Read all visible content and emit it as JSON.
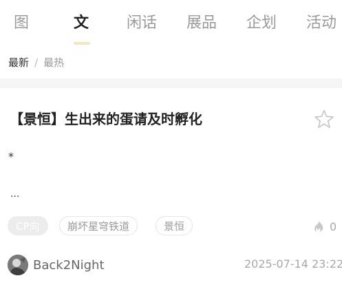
{
  "tabs": [
    {
      "label": "图",
      "active": false
    },
    {
      "label": "文",
      "active": true
    },
    {
      "label": "闲话",
      "active": false
    },
    {
      "label": "展品",
      "active": false
    },
    {
      "label": "企划",
      "active": false
    },
    {
      "label": "活动",
      "active": false
    }
  ],
  "sort": {
    "latest": "最新",
    "separator": "/",
    "hot": "最热"
  },
  "post": {
    "title": "【景恒】生出来的蛋请及时孵化",
    "excerpt_line1": "*",
    "excerpt_line2": "...",
    "tags": [
      "CP向",
      "崩坏星穹铁道",
      "景恒"
    ],
    "hot_count": "0",
    "author": "Back2Night",
    "timestamp": "2025-07-14 23:22",
    "favorite_icon": "star-outline-icon",
    "hot_icon": "flame-icon"
  },
  "colors": {
    "accent_underline": "#f5e6bd",
    "tag_primary_bg": "#ececec",
    "muted_text": "#9a9a9a"
  }
}
